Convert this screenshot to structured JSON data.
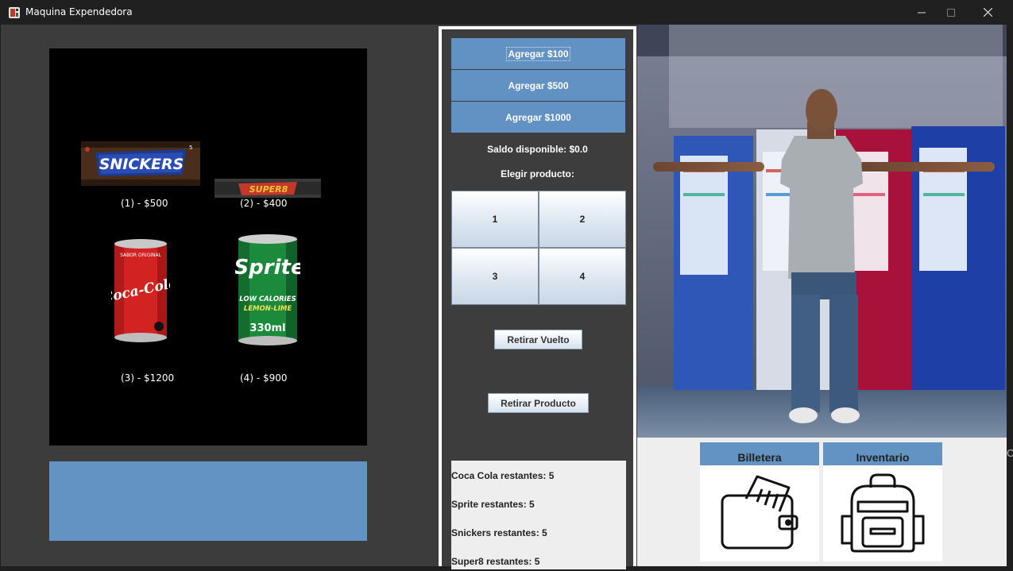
{
  "window": {
    "title": "Maquina Expendedora"
  },
  "products": [
    {
      "brand": "SNICKERS",
      "label": "(1) - $500"
    },
    {
      "brand": "SUPER8",
      "label": "(2) - $400"
    },
    {
      "brand": "Coca-Cola",
      "label": "(3) - $1200"
    },
    {
      "brand": "Sprite",
      "label": "(4) - $900"
    }
  ],
  "images": {
    "snickers_weight": "5",
    "coke_band": "SABOR ORIGINAL",
    "sprite_line1": "LOW CALORIES",
    "sprite_line2": "LEMON-LIME",
    "sprite_volume": "330ml"
  },
  "controls": {
    "add_100": "Agregar $100",
    "add_500": "Agregar $500",
    "add_1000": "Agregar $1000",
    "balance": "Saldo disponible: $0.0",
    "choose": "Elegir producto:",
    "grid": [
      "1",
      "2",
      "3",
      "4"
    ],
    "withdraw_change": "Retirar Vuelto",
    "withdraw_product": "Retirar Producto"
  },
  "inventory_lines": [
    "Coca Cola restantes: 5",
    "Sprite restantes: 5",
    "Snickers restantes: 5",
    "Super8 restantes: 5"
  ],
  "cards": {
    "wallet": "Billetera",
    "inventory": "Inventario"
  },
  "icons": {
    "app": "vending-machine-icon",
    "minimize": "minimize-icon",
    "maximize": "maximize-icon",
    "close": "close-icon",
    "wallet": "wallet-icon",
    "backpack": "backpack-icon"
  },
  "colors": {
    "button_blue": "#6292c3",
    "panel_dark": "#3c3c3c",
    "titlebar": "#202020"
  },
  "edge_char": "C"
}
